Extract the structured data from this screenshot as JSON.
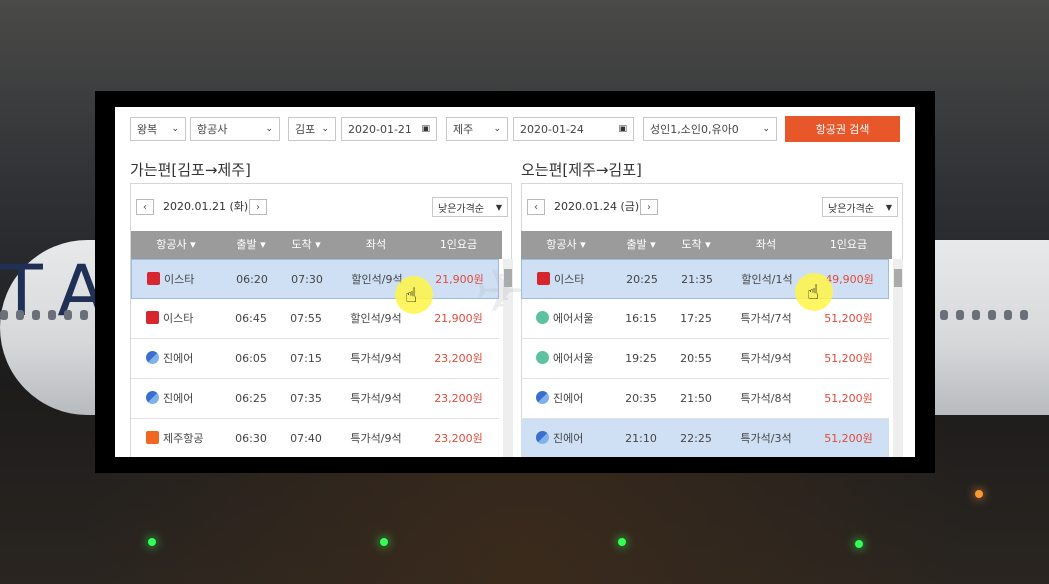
{
  "search_bar": {
    "trip_type": "왕복",
    "airline": "항공사",
    "origin": "김포",
    "depart_date": "2020-01-21",
    "destination": "제주",
    "return_date": "2020-01-24",
    "passengers": "성인1,소인0,유아0",
    "search_button": "항공권 검색"
  },
  "outbound": {
    "title": "가는편[김포→제주]",
    "date": "2020.01.21 (화)",
    "sort": "낮은가격순",
    "columns": [
      "항공사 ▾",
      "출발 ▾",
      "도착 ▾",
      "좌석",
      "1인요금"
    ],
    "rows": [
      {
        "airline": "이스타",
        "logo": "eastar-logo",
        "dep": "06:20",
        "arr": "07:30",
        "seat": "할인석/9석",
        "price": "21,900원"
      },
      {
        "airline": "이스타",
        "logo": "eastar-logo",
        "dep": "06:45",
        "arr": "07:55",
        "seat": "할인석/9석",
        "price": "21,900원"
      },
      {
        "airline": "진에어",
        "logo": "jinair-logo",
        "dep": "06:05",
        "arr": "07:15",
        "seat": "특가석/9석",
        "price": "23,200원"
      },
      {
        "airline": "진에어",
        "logo": "jinair-logo",
        "dep": "06:25",
        "arr": "07:35",
        "seat": "특가석/9석",
        "price": "23,200원"
      },
      {
        "airline": "제주항공",
        "logo": "jejuair-logo",
        "dep": "06:30",
        "arr": "07:40",
        "seat": "특가석/9석",
        "price": "23,200원"
      }
    ]
  },
  "inbound": {
    "title": "오는편[제주→김포]",
    "date": "2020.01.24 (금)",
    "sort": "낮은가격순",
    "columns": [
      "항공사 ▾",
      "출발 ▾",
      "도착 ▾",
      "좌석",
      "1인요금"
    ],
    "rows": [
      {
        "airline": "이스타",
        "logo": "eastar-logo",
        "dep": "20:25",
        "arr": "21:35",
        "seat": "할인석/1석",
        "price": "49,900원"
      },
      {
        "airline": "에어서울",
        "logo": "airseoul-logo",
        "dep": "16:15",
        "arr": "17:25",
        "seat": "특가석/7석",
        "price": "51,200원"
      },
      {
        "airline": "에어서울",
        "logo": "airseoul-logo",
        "dep": "19:25",
        "arr": "20:55",
        "seat": "특가석/9석",
        "price": "51,200원"
      },
      {
        "airline": "진에어",
        "logo": "jinair-logo",
        "dep": "20:35",
        "arr": "21:50",
        "seat": "특가석/8석",
        "price": "51,200원"
      },
      {
        "airline": "진에어",
        "logo": "jinair-logo",
        "dep": "21:10",
        "arr": "22:25",
        "seat": "특가석/3석",
        "price": "51,200원"
      }
    ]
  },
  "background_text": "TA",
  "colors": {
    "accent": "#e8572a",
    "price": "#e04a3a",
    "header": "#9b9b9b",
    "selected_row": "#cfe0f5"
  }
}
